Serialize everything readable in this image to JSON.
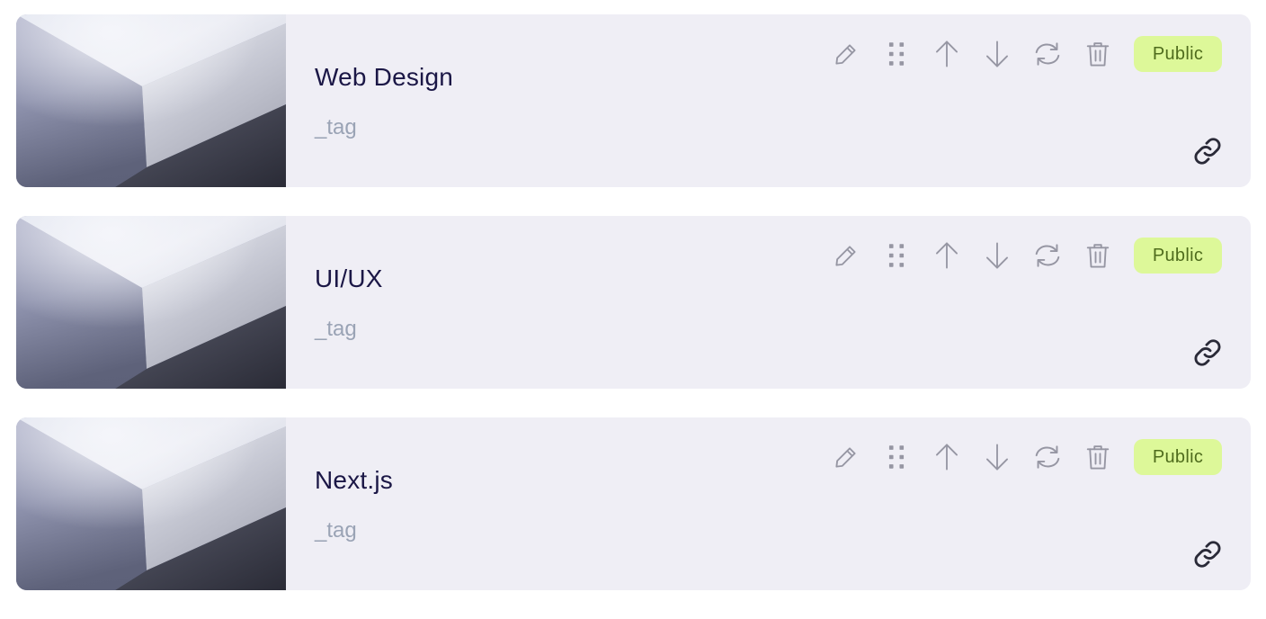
{
  "colors": {
    "card_bg": "#efeef5",
    "title": "#1b1746",
    "tag": "#9aa3b5",
    "icon": "#9696a3",
    "link_icon": "#2a2a38",
    "badge_bg": "#ddf899",
    "badge_text": "#4f6c1d"
  },
  "icons": [
    "pencil-icon",
    "grip-dots-icon",
    "arrow-up-icon",
    "arrow-down-icon",
    "refresh-icon",
    "trash-icon",
    "link-icon"
  ],
  "cards": [
    {
      "title": "Web Design",
      "tag": "_tag",
      "badge": "Public"
    },
    {
      "title": "UI/UX",
      "tag": "_tag",
      "badge": "Public"
    },
    {
      "title": "Next.js",
      "tag": "_tag",
      "badge": "Public"
    }
  ]
}
